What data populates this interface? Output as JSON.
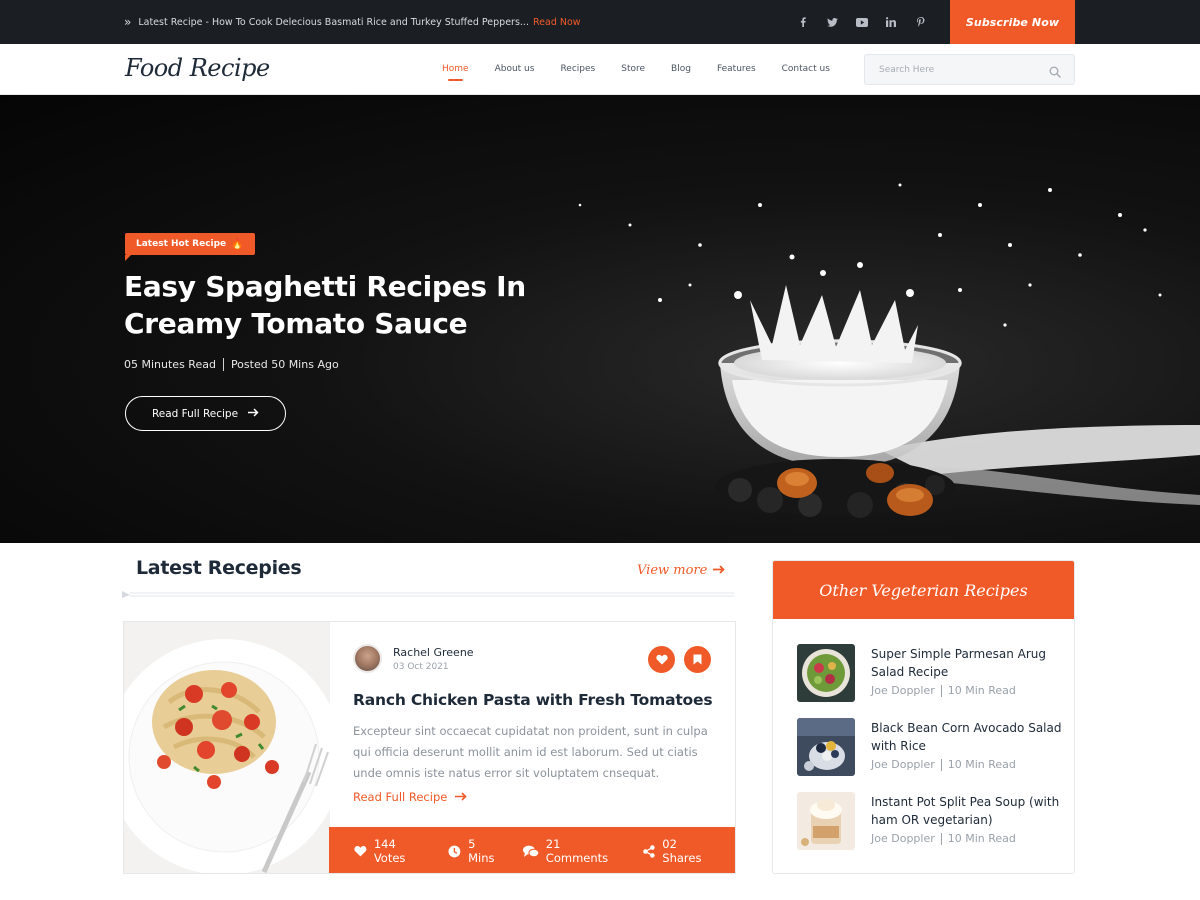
{
  "topbar": {
    "news_text": "Latest Recipe - How To Cook Delecious Basmati Rice and Turkey Stuffed Peppers...",
    "news_link": "Read Now",
    "social_icons": [
      "facebook-icon",
      "twitter-icon",
      "youtube-icon",
      "linkedin-icon",
      "pinterest-icon"
    ],
    "subscribe_label": "Subscribe Now"
  },
  "navbar": {
    "logo": "Food Recipe",
    "menu": [
      {
        "label": "Home",
        "active": true
      },
      {
        "label": "About us",
        "active": false
      },
      {
        "label": "Recipes",
        "active": false
      },
      {
        "label": "Store",
        "active": false
      },
      {
        "label": "Blog",
        "active": false
      },
      {
        "label": "Features",
        "active": false
      },
      {
        "label": "Contact us",
        "active": false
      }
    ],
    "search_placeholder": "Search Here"
  },
  "hero": {
    "badge": "Latest Hot Recipe",
    "title": "Easy Spaghetti Recipes In Creamy Tomato Sauce",
    "read_time": "05 Minutes Read",
    "posted": "Posted 50 Mins Ago",
    "button": "Read Full Recipe"
  },
  "latest": {
    "title": "Latest Recepies",
    "view_more": "View more",
    "card": {
      "author": "Rachel Greene",
      "date": "03 Oct 2021",
      "title": "Ranch Chicken Pasta with Fresh Tomatoes",
      "excerpt": "Excepteur sint occaecat cupidatat non proident, sunt in culpa qui officia deserunt mollit anim id est laborum. Sed ut ciatis unde omnis iste natus error sit voluptatem cnsequat.",
      "read_more": "Read Full Recipe",
      "stats": {
        "votes": "144 Votes",
        "time": "5 Mins",
        "comments": "21 Comments",
        "shares": "02 Shares"
      }
    }
  },
  "sidebar": {
    "title": "Other Vegeterian Recipes",
    "items": [
      {
        "title": "Super Simple Parmesan Arug Salad Recipe",
        "author": "Joe Doppler",
        "read": "10 Min Read"
      },
      {
        "title": "Black Bean Corn Avocado Salad with Rice",
        "author": "Joe Doppler",
        "read": "10 Min Read"
      },
      {
        "title": "Instant Pot Split Pea Soup (with ham OR vegetarian)",
        "author": "Joe Doppler",
        "read": "10 Min Read"
      }
    ]
  },
  "colors": {
    "accent": "#f05a28",
    "dark": "#1b1f24",
    "heading": "#1e2a38",
    "muted": "#8c939c"
  }
}
